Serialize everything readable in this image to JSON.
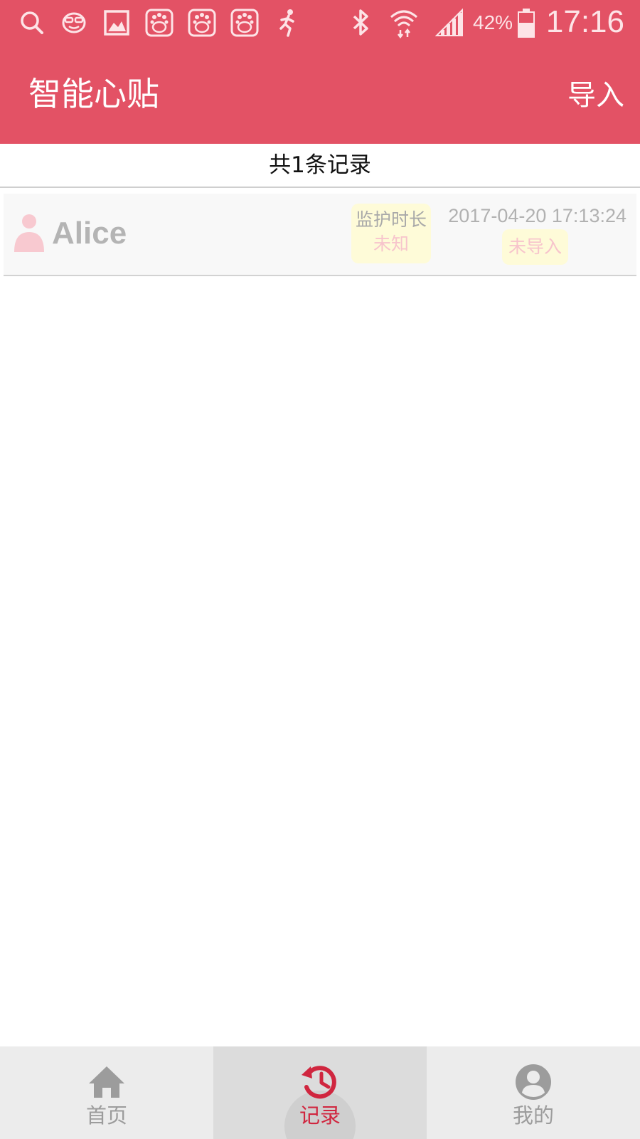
{
  "status_bar": {
    "icons": [
      "search-icon",
      "face-mask-icon",
      "gallery-icon",
      "baidu-paw-icon",
      "baidu-paw-icon",
      "baidu-paw-icon",
      "running-man-icon",
      "bluetooth-icon",
      "wifi-icon",
      "signal-icon",
      "battery-icon"
    ],
    "battery_percent": "42%",
    "time": "17:16"
  },
  "app_bar": {
    "title": "智能心贴",
    "action_label": "导入"
  },
  "records": {
    "count_label": "共1条记录",
    "items": [
      {
        "name": "Alice",
        "avatar_icon": "person-icon",
        "duration_label": "监护时长",
        "duration_value": "未知",
        "timestamp": "2017-04-20 17:13:24",
        "status": "未导入"
      }
    ]
  },
  "bottom_nav": {
    "items": [
      {
        "label": "首页",
        "icon": "home-icon",
        "active": false
      },
      {
        "label": "记录",
        "icon": "history-icon",
        "active": true
      },
      {
        "label": "我的",
        "icon": "account-icon",
        "active": false
      }
    ]
  },
  "colors": {
    "primary": "#e35265",
    "accent": "#d0263f",
    "badge_bg": "#fefbd8",
    "badge_text": "#f7c4cc",
    "nav_bg": "#ececec"
  }
}
